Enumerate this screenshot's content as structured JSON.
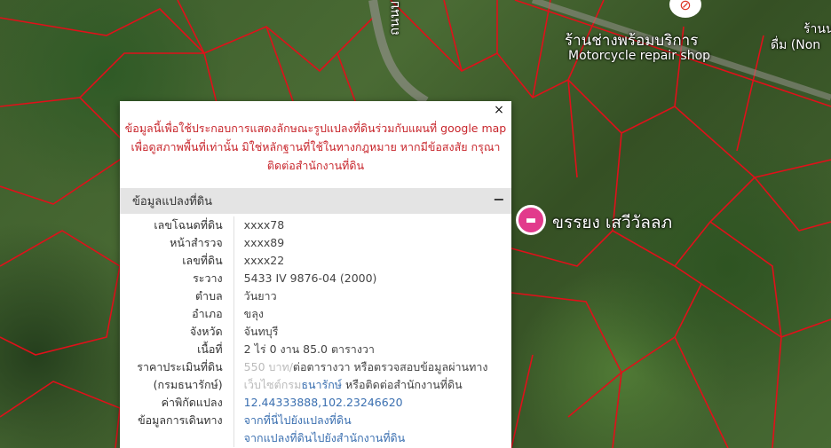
{
  "map": {
    "labels": {
      "shop_thai": "ร้านช่างพร้อมบริการ",
      "shop_en": "Motorcycle repair shop",
      "corner_thai": "ร้านน",
      "corner_en": "ดื่ม (Non",
      "road": "ถนนบางคล้า",
      "place": "ขรรยง เสวีวัลลภ"
    },
    "pin_icon": "bed-icon",
    "poi_icon": "no-entry-icon"
  },
  "panel": {
    "close_label": "×",
    "notice": "ข้อมูลนี้เพื่อใช้ประกอบการแสดงลักษณะรูปแปลงที่ดินร่วมกับแผนที่ google map เพื่อดูสภาพพื้นที่เท่านั้น มิใช่หลักฐานที่ใช้ในทางกฎหมาย หากมีข้อสงสัย กรุณาติดต่อสำนักงานที่ดิน",
    "section_title": "ข้อมูลแปลงที่ดิน",
    "collapse_label": "−",
    "rows": [
      {
        "key": "เลขโฉนดที่ดิน",
        "value": "xxxx78"
      },
      {
        "key": "หน้าสำรวจ",
        "value": "xxxx89"
      },
      {
        "key": "เลขที่ดิน",
        "value": "xxxx22"
      },
      {
        "key": "ระวาง",
        "value": "5433 IV 9876-04 (2000)"
      },
      {
        "key": "ตำบล",
        "value": "วันยาว"
      },
      {
        "key": "อำเภอ",
        "value": "ขลุง"
      },
      {
        "key": "จังหวัด",
        "value": "จันทบุรี"
      },
      {
        "key": "เนื้อที่",
        "value": "2 ไร่ 0 งาน 85.0 ตารางวา"
      }
    ],
    "price": {
      "key": "ราคาประเมินที่ดิน",
      "value_faded": "550 บาท/",
      "value": "ต่อตารางวา หรือตรวจสอบข้อมูลผ่านทาง"
    },
    "treasury": {
      "key": "(กรมธนารักษ์)",
      "link_faded": "เว็บไซต์กรม",
      "link": "ธนารักษ์",
      "suffix": " หรือติดต่อสำนักงานที่ดิน"
    },
    "coords": {
      "key": "ค่าพิกัดแปลง",
      "value": "12.44333888,102.23246620"
    },
    "travel": {
      "key": "ข้อมูลการเดินทาง",
      "link1": "จากที่นี่ไปยังแปลงที่ดิน",
      "link2": "จากแปลงที่ดินไปยังสำนักงานที่ดิน"
    }
  }
}
